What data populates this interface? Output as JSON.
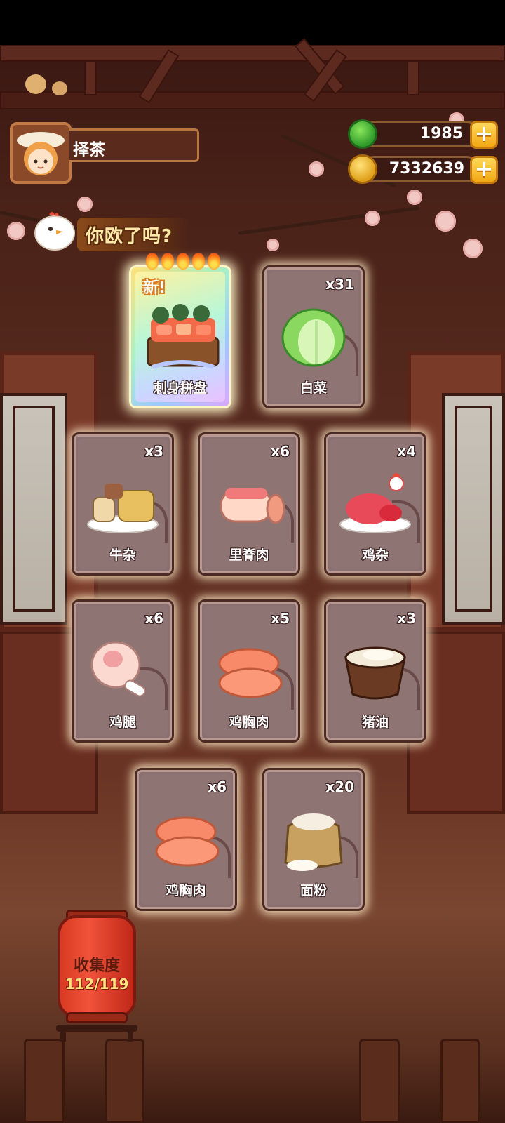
{
  "player": {
    "name": "择茶"
  },
  "currency": {
    "jade": "1985",
    "coins": "7332639"
  },
  "banner": {
    "text": "你欧了吗?"
  },
  "featured_card": {
    "name": "刺身拼盘",
    "badge": "新!",
    "stars": 5
  },
  "cards": [
    {
      "name": "白菜",
      "count": "x31",
      "icon": "cabbage-icon"
    },
    {
      "name": "牛杂",
      "count": "x3",
      "icon": "beef-offal-icon"
    },
    {
      "name": "里脊肉",
      "count": "x6",
      "icon": "tenderloin-icon"
    },
    {
      "name": "鸡杂",
      "count": "x4",
      "icon": "chicken-offal-icon"
    },
    {
      "name": "鸡腿",
      "count": "x6",
      "icon": "chicken-leg-icon"
    },
    {
      "name": "鸡胸肉",
      "count": "x5",
      "icon": "chicken-breast-icon"
    },
    {
      "name": "猪油",
      "count": "x3",
      "icon": "lard-icon"
    },
    {
      "name": "鸡胸肉",
      "count": "x6",
      "icon": "chicken-breast-icon"
    },
    {
      "name": "面粉",
      "count": "x20",
      "icon": "flour-sack-icon"
    }
  ],
  "collection": {
    "label": "收集度",
    "progress": "112/119"
  },
  "colors": {
    "accent": "#f2a814",
    "jade": "#3aa83a",
    "card_bg": "#8a7070"
  }
}
